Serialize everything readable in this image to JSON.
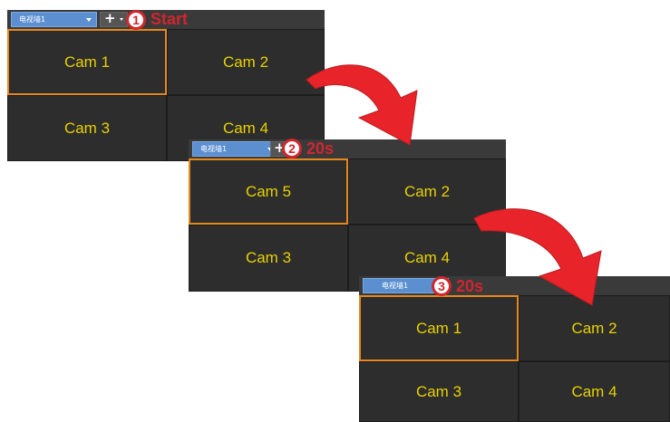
{
  "accent_color": "#d0262e",
  "selection_color": "#e6871e",
  "cam_label_color": "#e8d100",
  "panels": [
    {
      "wall_select": "电视墙1",
      "step_number": "1",
      "step_text": "Start",
      "cells": [
        "Cam 1",
        "Cam 2",
        "Cam 3",
        "Cam 4"
      ]
    },
    {
      "wall_select": "电视墙1",
      "step_number": "2",
      "step_text": "20s",
      "cells": [
        "Cam 5",
        "Cam 2",
        "Cam 3",
        "Cam 4"
      ]
    },
    {
      "wall_select": "电视墙1",
      "step_number": "3",
      "step_text": "20s",
      "cells": [
        "Cam 1",
        "Cam 2",
        "Cam 3",
        "Cam 4"
      ]
    }
  ]
}
